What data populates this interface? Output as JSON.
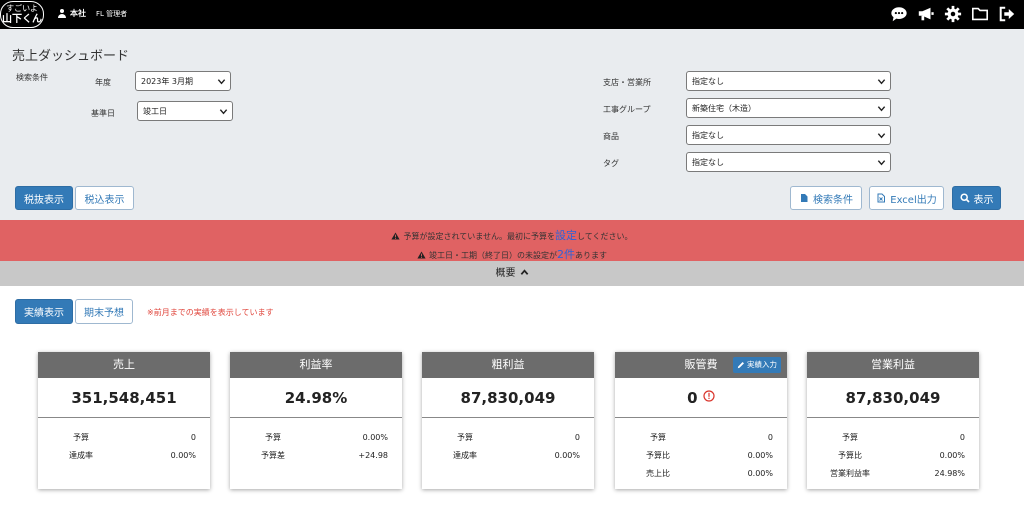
{
  "header": {
    "logo_line1": "すごいよ",
    "logo_line2": "山下くん",
    "user_name": "本社",
    "user_role": "FL 管理者",
    "icons": [
      "chat-icon",
      "megaphone-icon",
      "gear-icon",
      "folder-icon",
      "logout-icon"
    ]
  },
  "filters": {
    "page_title": "売上ダッシュボード",
    "search_conditions_label": "検索条件",
    "year_label": "年度",
    "year_value": "2023年 3月期",
    "base_date_label": "基準日",
    "base_date_value": "竣工日",
    "branch_label": "支店・営業所",
    "branch_value": "指定なし",
    "construction_group_label": "工事グループ",
    "construction_group_value": "新築住宅（木造）",
    "product_label": "商品",
    "product_value": "指定なし",
    "tag_label": "タグ",
    "tag_value": "指定なし"
  },
  "toolbar": {
    "tax_excluded": "税抜表示",
    "tax_included": "税込表示",
    "search_conditions": "検索条件",
    "excel_export": "Excel出力",
    "display": "表示"
  },
  "alert": {
    "line1_before": "予算が設定されていません。最初に予算を",
    "line1_link": "設定",
    "line1_after": "してください。",
    "line2_before": "竣工日・工期（終了日）の未設定が",
    "line2_link": "2件",
    "line2_after": "あります"
  },
  "summary": {
    "label": "概要"
  },
  "view": {
    "actual": "実績表示",
    "forecast": "期末予想",
    "note": "※前月までの実績を表示しています"
  },
  "cards": [
    {
      "title": "売上",
      "value": "351,548,451",
      "rows": [
        {
          "k": "予算",
          "v": "0"
        },
        {
          "k": "達成率",
          "v": "0.00%"
        }
      ]
    },
    {
      "title": "利益率",
      "value": "24.98%",
      "rows": [
        {
          "k": "予算",
          "v": "0.00%"
        },
        {
          "k": "予算差",
          "v": "+24.98"
        }
      ]
    },
    {
      "title": "粗利益",
      "value": "87,830,049",
      "rows": [
        {
          "k": "予算",
          "v": "0"
        },
        {
          "k": "達成率",
          "v": "0.00%"
        }
      ]
    },
    {
      "title": "販管費",
      "value": "0",
      "edit_label": "実績入力",
      "rows": [
        {
          "k": "予算",
          "v": "0"
        },
        {
          "k": "予算比",
          "v": "0.00%"
        },
        {
          "k": "売上比",
          "v": "0.00%"
        }
      ]
    },
    {
      "title": "営業利益",
      "value": "87,830,049",
      "rows": [
        {
          "k": "予算",
          "v": "0"
        },
        {
          "k": "予算比",
          "v": "0.00%"
        },
        {
          "k": "営業利益率",
          "v": "24.98%"
        }
      ]
    }
  ],
  "colors": {
    "primary": "#337ab7",
    "alert_bg": "#e06263",
    "card_header": "#6c6c6c",
    "note_red": "#e0463c"
  }
}
